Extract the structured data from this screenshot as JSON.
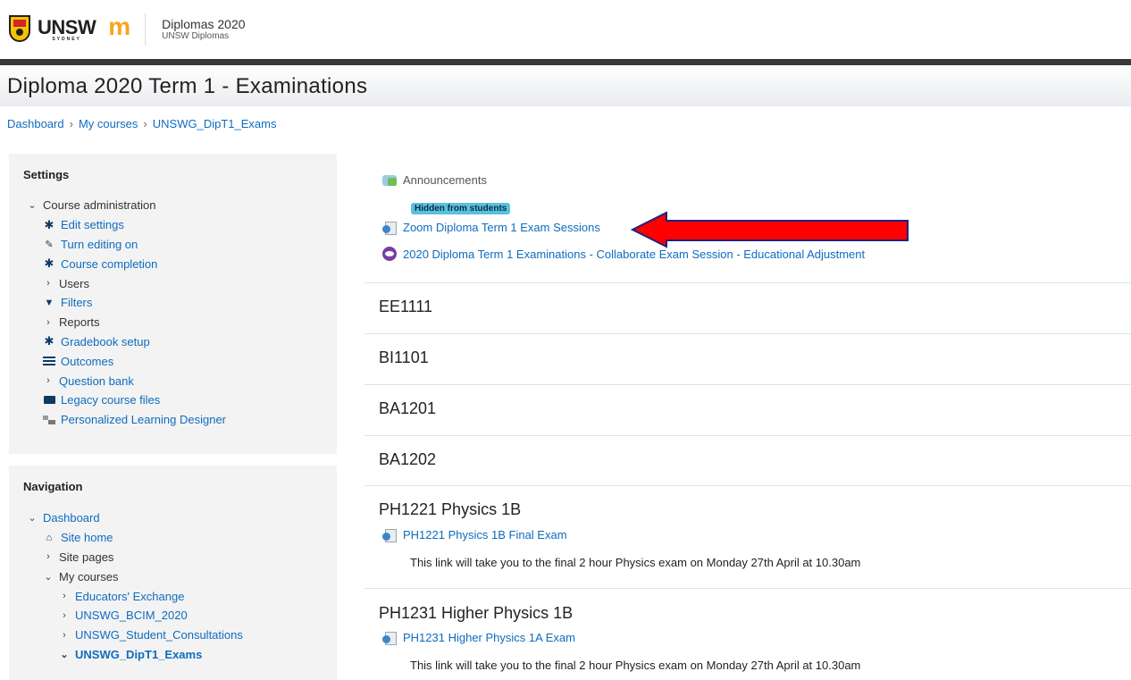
{
  "header": {
    "logo_text": "UNSW",
    "logo_subtext": "SYDNEY",
    "moodle_letter": "m",
    "site_name": "Diplomas 2020",
    "site_subname": "UNSW Diplomas"
  },
  "page": {
    "title": "Diploma 2020 Term 1 - Examinations"
  },
  "breadcrumb": [
    "Dashboard",
    "My courses",
    "UNSWG_DipT1_Exams"
  ],
  "breadcrumb_sep": "›",
  "settings": {
    "title": "Settings",
    "course_admin": "Course administration",
    "items": {
      "edit_settings": "Edit settings",
      "turn_editing_on": "Turn editing on",
      "course_completion": "Course completion",
      "users": "Users",
      "filters": "Filters",
      "reports": "Reports",
      "gradebook_setup": "Gradebook setup",
      "outcomes": "Outcomes",
      "question_bank": "Question bank",
      "legacy_files": "Legacy course files",
      "pld": "Personalized Learning Designer"
    }
  },
  "navigation": {
    "title": "Navigation",
    "dashboard": "Dashboard",
    "site_home": "Site home",
    "site_pages": "Site pages",
    "my_courses": "My courses",
    "courses": [
      "Educators' Exchange",
      "UNSWG_BCIM_2020",
      "UNSWG_Student_Consultations",
      "UNSWG_DipT1_Exams"
    ]
  },
  "main": {
    "announcements": "Announcements",
    "hidden_badge": "Hidden from students",
    "zoom_link": "Zoom Diploma Term 1 Exam Sessions",
    "collab_link": "2020 Diploma Term 1 Examinations - Collaborate Exam Session - Educational Adjustment",
    "sections": [
      {
        "title": "EE1111"
      },
      {
        "title": "BI1101"
      },
      {
        "title": "BA1201"
      },
      {
        "title": "BA1202"
      },
      {
        "title": "PH1221 Physics 1B",
        "activity": "PH1221 Physics 1B Final Exam",
        "description": "This link will take you to the final 2 hour Physics exam on Monday 27th April at 10.30am"
      },
      {
        "title": "PH1231 Higher Physics 1B",
        "activity": "PH1231 Higher Physics 1A Exam",
        "description": "This link will take you to the final 2 hour Physics exam on Monday 27th April at 10.30am"
      }
    ]
  },
  "colors": {
    "link": "#0f6cbf",
    "badge": "#5bc0de",
    "arrow": "#ff0000",
    "dark_bar": "#3a3a3a"
  }
}
